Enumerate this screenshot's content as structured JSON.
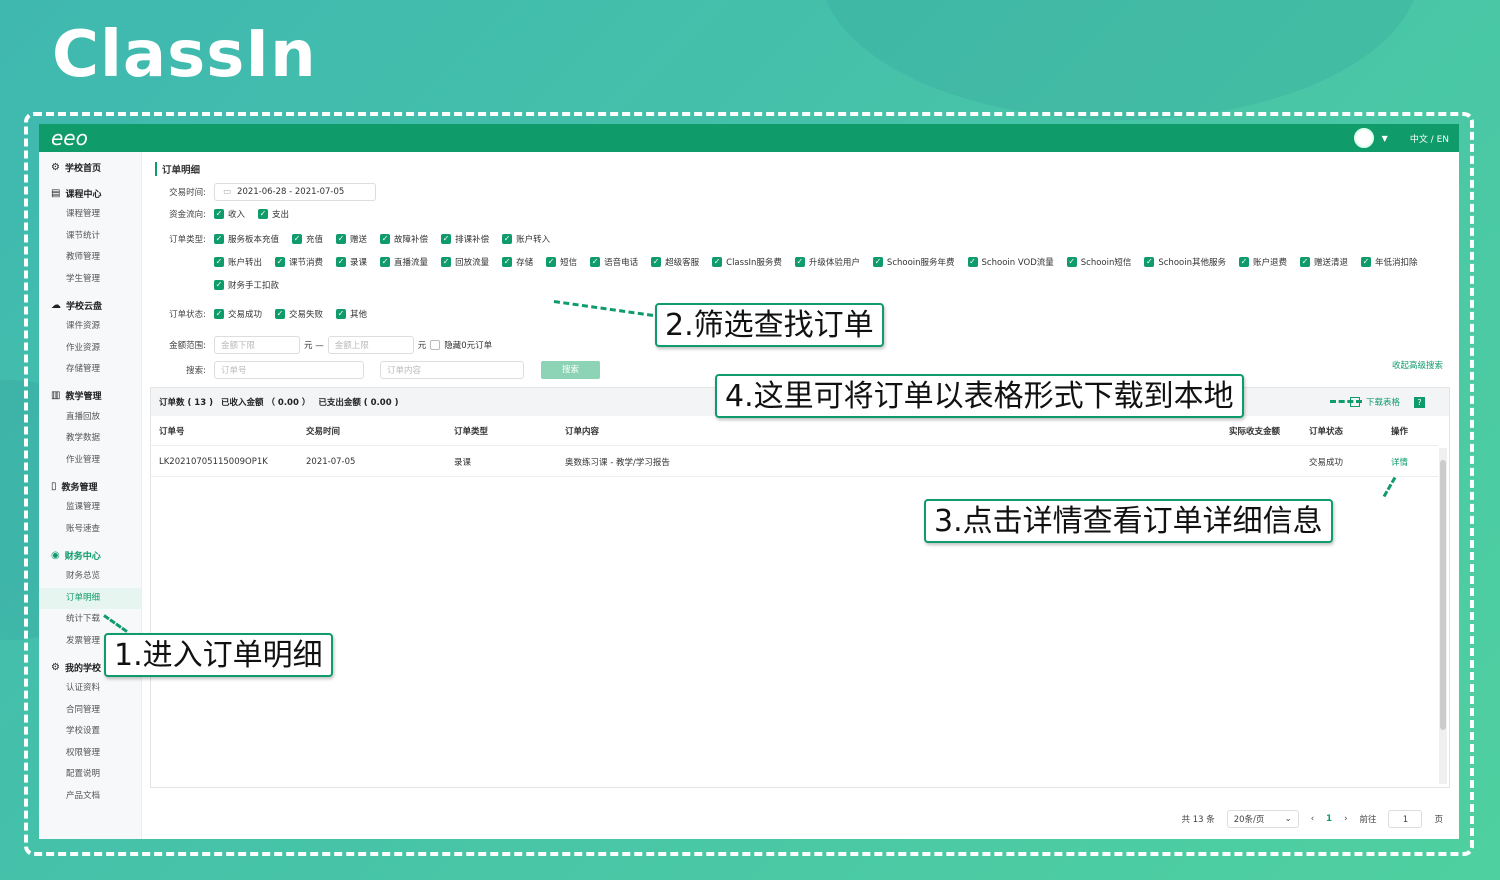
{
  "brand": {
    "logo": "ClassIn",
    "app_logo": "eeo",
    "lang": "中文 / EN"
  },
  "sidebar": {
    "groups": [
      {
        "label": "学校首页",
        "icon": "gear-icon",
        "items": []
      },
      {
        "label": "课程中心",
        "icon": "calendar-icon",
        "items": [
          "课程管理",
          "课节统计",
          "教师管理",
          "学生管理"
        ]
      },
      {
        "label": "学校云盘",
        "icon": "cloud-icon",
        "items": [
          "课件资源",
          "作业资源",
          "存储管理"
        ]
      },
      {
        "label": "教学管理",
        "icon": "chart-icon",
        "items": [
          "直播回放",
          "教学数据",
          "作业管理"
        ]
      },
      {
        "label": "教务管理",
        "icon": "books-icon",
        "items": [
          "监课管理",
          "账号速查"
        ]
      },
      {
        "label": "财务中心",
        "icon": "finance-icon",
        "items": [
          "财务总览",
          "订单明细",
          "统计下载",
          "发票管理"
        ]
      },
      {
        "label": "我的学校",
        "icon": "school-icon",
        "items": [
          "认证资料",
          "合同管理",
          "学校设置",
          "权限管理",
          "配置说明",
          "产品文档"
        ]
      }
    ]
  },
  "main": {
    "title": "订单明细",
    "filters": {
      "date_label": "交易时间:",
      "date_range": "2021-06-28  - 2021-07-05",
      "flow_label": "资金流向:",
      "flow": [
        "收入",
        "支出"
      ],
      "type_label": "订单类型:",
      "types_row1": [
        "服务板本充值",
        "充值",
        "赠送",
        "故障补偿",
        "排课补偿",
        "账户转入"
      ],
      "types_row2": [
        "账户转出",
        "课节消费",
        "录课",
        "直播流量",
        "回放流量",
        "存储",
        "短信",
        "语音电话",
        "超级客服",
        "ClassIn服务费",
        "升级体验用户",
        "Schooin服务年费",
        "Schooin VOD流量",
        "Schooin短信",
        "Schooin其他服务",
        "账户退费",
        "赠送清退",
        "年低消扣除"
      ],
      "types_row3": [
        "财务手工扣款"
      ],
      "status_label": "订单状态:",
      "status": [
        "交易成功",
        "交易失败",
        "其他"
      ],
      "amount_label": "金额范围:",
      "amount_min_ph": "金额下限",
      "amount_sep": "元 —",
      "amount_max_ph": "金额上限",
      "amount_unit": "元",
      "hide_zero": "隐藏0元订单",
      "search_label": "搜索:",
      "order_no_ph": "订单号",
      "order_content_ph": "订单内容",
      "search_btn": "搜索",
      "advanced": "收起高级搜索"
    },
    "summary": {
      "count": "订单数 ( 13 )",
      "income": "已收入金额 （ 0.00 ）",
      "expense": "已支出金额 ( 0.00 )",
      "download": "下载表格",
      "help": "?"
    },
    "columns": [
      "订单号",
      "交易时间",
      "订单类型",
      "订单内容",
      "实际收支金额",
      "订单状态",
      "操作"
    ],
    "rows": [
      {
        "id": "LK20210705115009OP1K",
        "time": "2021-07-05",
        "type": "录课",
        "content": "奥数练习课 - 教学/学习报告",
        "amount": "",
        "status": "交易成功",
        "action": "详情"
      }
    ],
    "pager": {
      "total": "共 13 条",
      "size": "20条/页",
      "page": "1",
      "goto": "前往",
      "goto_val": "1",
      "page_unit": "页"
    }
  },
  "callouts": [
    "1.进入订单明细",
    "2.筛选查找订单",
    "3.点击详情查看订单详细信息",
    "4.这里可将订单以表格形式下载到本地"
  ]
}
